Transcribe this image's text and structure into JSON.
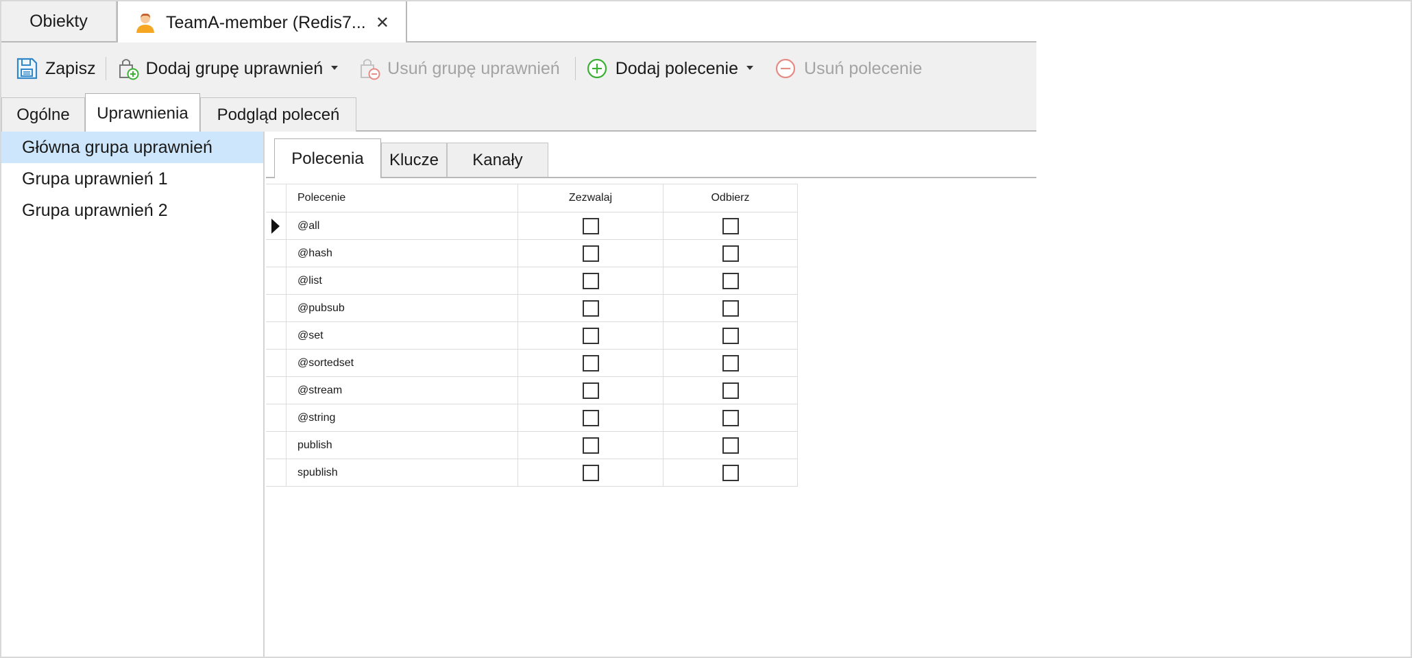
{
  "doc_tabs": {
    "objects_label": "Obiekty",
    "active_label": "TeamA-member (Redis7..."
  },
  "toolbar": {
    "save_label": "Zapisz",
    "add_group_label": "Dodaj grupę uprawnień",
    "remove_group_label": "Usuń grupę uprawnień",
    "add_command_label": "Dodaj polecenie",
    "remove_command_label": "Usuń polecenie"
  },
  "section_tabs": [
    "Ogólne",
    "Uprawnienia",
    "Podgląd poleceń"
  ],
  "tree": {
    "items": [
      "Główna grupa uprawnień",
      "Grupa uprawnień 1",
      "Grupa uprawnień 2"
    ],
    "selected_index": 0
  },
  "inner_tabs": [
    "Polecenia",
    "Klucze",
    "Kanały"
  ],
  "grid": {
    "columns": [
      "Polecenie",
      "Zezwalaj",
      "Odbierz"
    ],
    "rows": [
      {
        "command": "@all",
        "allow": false,
        "revoke": false
      },
      {
        "command": "@hash",
        "allow": false,
        "revoke": false
      },
      {
        "command": "@list",
        "allow": false,
        "revoke": false
      },
      {
        "command": "@pubsub",
        "allow": false,
        "revoke": false
      },
      {
        "command": "@set",
        "allow": false,
        "revoke": false
      },
      {
        "command": "@sortedset",
        "allow": false,
        "revoke": false
      },
      {
        "command": "@stream",
        "allow": false,
        "revoke": false
      },
      {
        "command": "@string",
        "allow": false,
        "revoke": false
      },
      {
        "command": "publish",
        "allow": false,
        "revoke": false
      },
      {
        "command": "spublish",
        "allow": false,
        "revoke": false
      }
    ],
    "current_row_index": 0
  },
  "colors": {
    "selection": "#cde6fb",
    "add_green": "#3cb034",
    "remove_red": "#e58b86",
    "save_blue": "#2f86c9"
  }
}
